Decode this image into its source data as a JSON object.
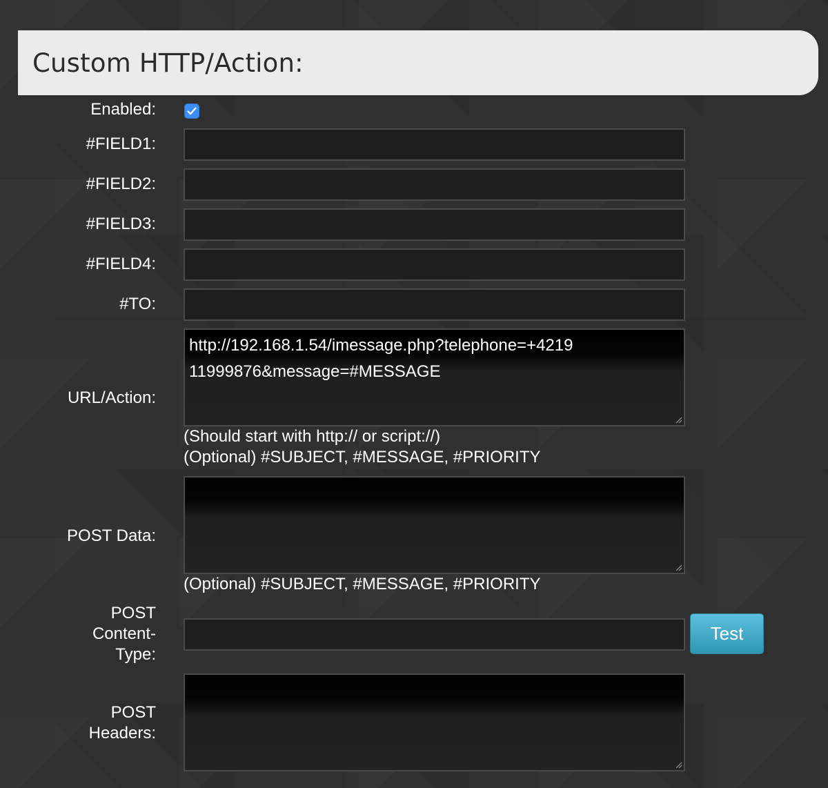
{
  "section": {
    "title": "Custom HTTP/Action:"
  },
  "form": {
    "enabled": {
      "label": "Enabled:",
      "checked": true
    },
    "field1": {
      "label": "#FIELD1:",
      "value": ""
    },
    "field2": {
      "label": "#FIELD2:",
      "value": ""
    },
    "field3": {
      "label": "#FIELD3:",
      "value": ""
    },
    "field4": {
      "label": "#FIELD4:",
      "value": ""
    },
    "to": {
      "label": "#TO:",
      "value": ""
    },
    "url_action": {
      "label": "URL/Action:",
      "value": "http://192.168.1.54/imessage.php?telephone=+421911999876&message=#MESSAGE",
      "hint_line1": "(Should start with http:// or script://)",
      "hint_line2": "(Optional) #SUBJECT, #MESSAGE, #PRIORITY"
    },
    "post_data": {
      "label": "POST Data:",
      "value": "",
      "hint": "(Optional) #SUBJECT, #MESSAGE, #PRIORITY"
    },
    "post_content_type": {
      "label": "POST Content-Type:",
      "value": ""
    },
    "test_button": {
      "label": "Test"
    },
    "post_headers": {
      "label": "POST Headers:",
      "value": ""
    }
  },
  "icons": {
    "checkbox": "checkmark-icon",
    "resize": "resize-grip-icon"
  },
  "colors": {
    "checkbox": "#3e8ef7",
    "button": "#5bc0de",
    "header_bg": "#ebebeb"
  }
}
